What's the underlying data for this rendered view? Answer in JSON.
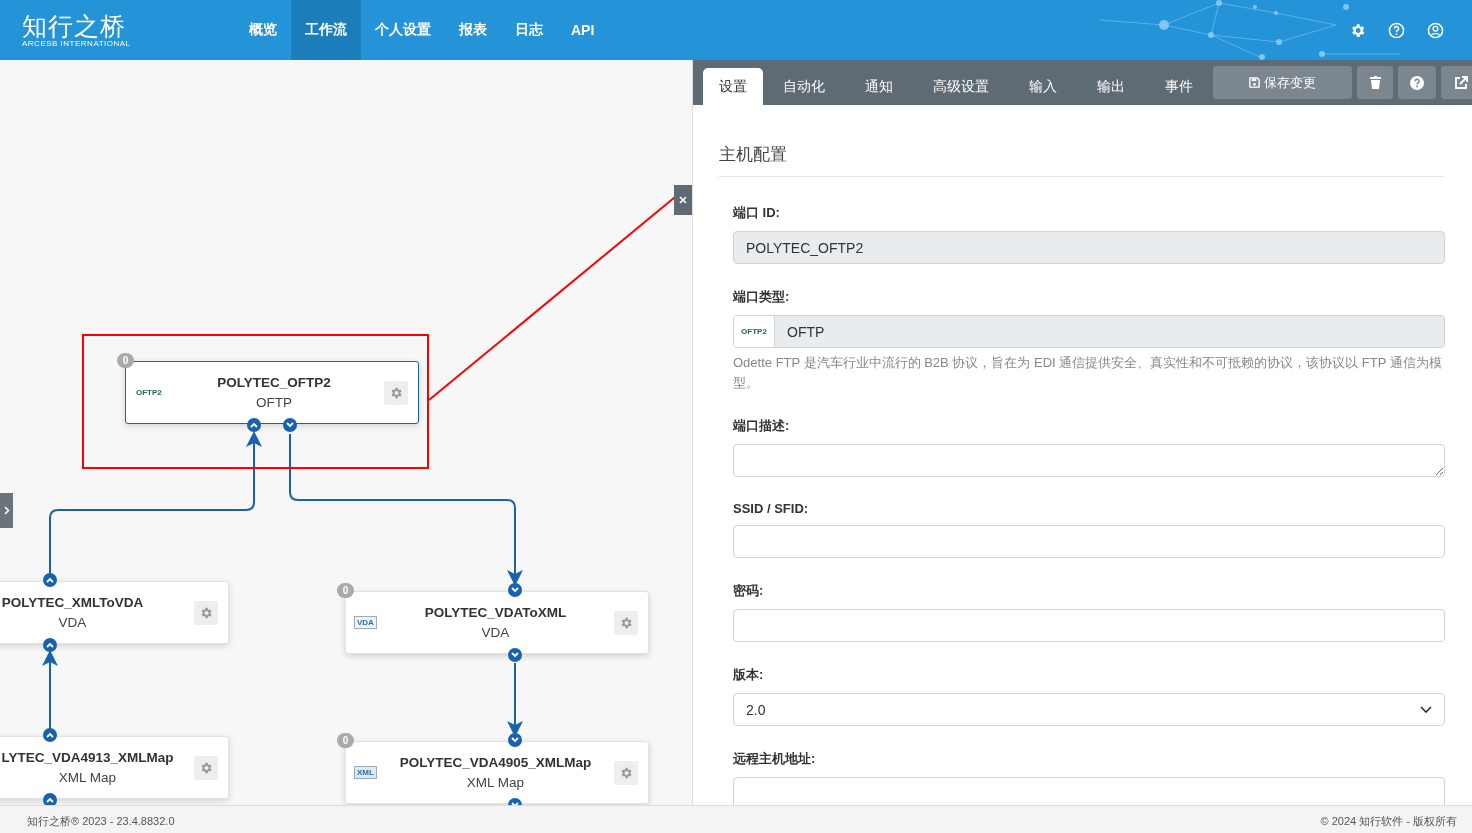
{
  "header": {
    "logo": {
      "text": "知行之桥",
      "subtitle": "ARCESB INTERNATIONAL"
    },
    "nav": [
      {
        "label": "概览",
        "selected": false
      },
      {
        "label": "工作流",
        "selected": true
      },
      {
        "label": "个人设置",
        "selected": false
      },
      {
        "label": "报表",
        "selected": false
      },
      {
        "label": "日志",
        "selected": false
      },
      {
        "label": "API",
        "selected": false
      }
    ]
  },
  "canvas": {
    "nodes": [
      {
        "title": "POLYTEC_OFTP2",
        "type": "OFTP",
        "badge": "0",
        "icon": {
          "kind": "oftp",
          "label": "OFTP2"
        },
        "selected": true
      },
      {
        "title": "POLYTEC_XMLToVDA",
        "type": "VDA",
        "selected": false
      },
      {
        "title": "POLYTEC_VDAToXML",
        "type": "VDA",
        "badge": "0",
        "icon": {
          "kind": "vda",
          "label": "VDA"
        },
        "selected": false
      },
      {
        "title": "LYTEC_VDA4913_XMLMap",
        "type": "XML Map",
        "selected": false
      },
      {
        "title": "POLYTEC_VDA4905_XMLMap",
        "type": "XML Map",
        "badge": "0",
        "icon": {
          "kind": "xml",
          "label": "XML"
        },
        "selected": false
      }
    ]
  },
  "panel": {
    "tabs": [
      {
        "label": "设置",
        "selected": true
      },
      {
        "label": "自动化",
        "selected": false
      },
      {
        "label": "通知",
        "selected": false
      },
      {
        "label": "高级设置",
        "selected": false
      },
      {
        "label": "输入",
        "selected": false
      },
      {
        "label": "输出",
        "selected": false
      },
      {
        "label": "事件",
        "selected": false
      }
    ],
    "save_button": "保存变更",
    "section_title": "主机配置",
    "fields": [
      {
        "label": "端口 ID:",
        "kind": "text",
        "value": "POLYTEC_OFTP2",
        "readonly": true
      },
      {
        "label": "端口类型:",
        "kind": "addon",
        "addon": "OFTP2",
        "value": "OFTP",
        "readonly": true,
        "help": "Odette FTP 是汽车行业中流行的 B2B 协议，旨在为 EDI 通信提供安全、真实性和不可抵赖的协议，该协议以 FTP 通信为模型。"
      },
      {
        "label": "端口描述:",
        "kind": "textarea",
        "readonly": false
      },
      {
        "label": "SSID / SFID:",
        "kind": "text",
        "readonly": false
      },
      {
        "label": "密码:",
        "kind": "password",
        "readonly": false
      },
      {
        "label": "版本:",
        "kind": "select",
        "value": "2.0",
        "readonly": false
      },
      {
        "label": "远程主机地址:",
        "kind": "text",
        "readonly": false
      }
    ]
  },
  "footer": {
    "left": "知行之桥® 2023 - 23.4.8832.0",
    "right": "© 2024 知行软件 - 版权所有"
  }
}
